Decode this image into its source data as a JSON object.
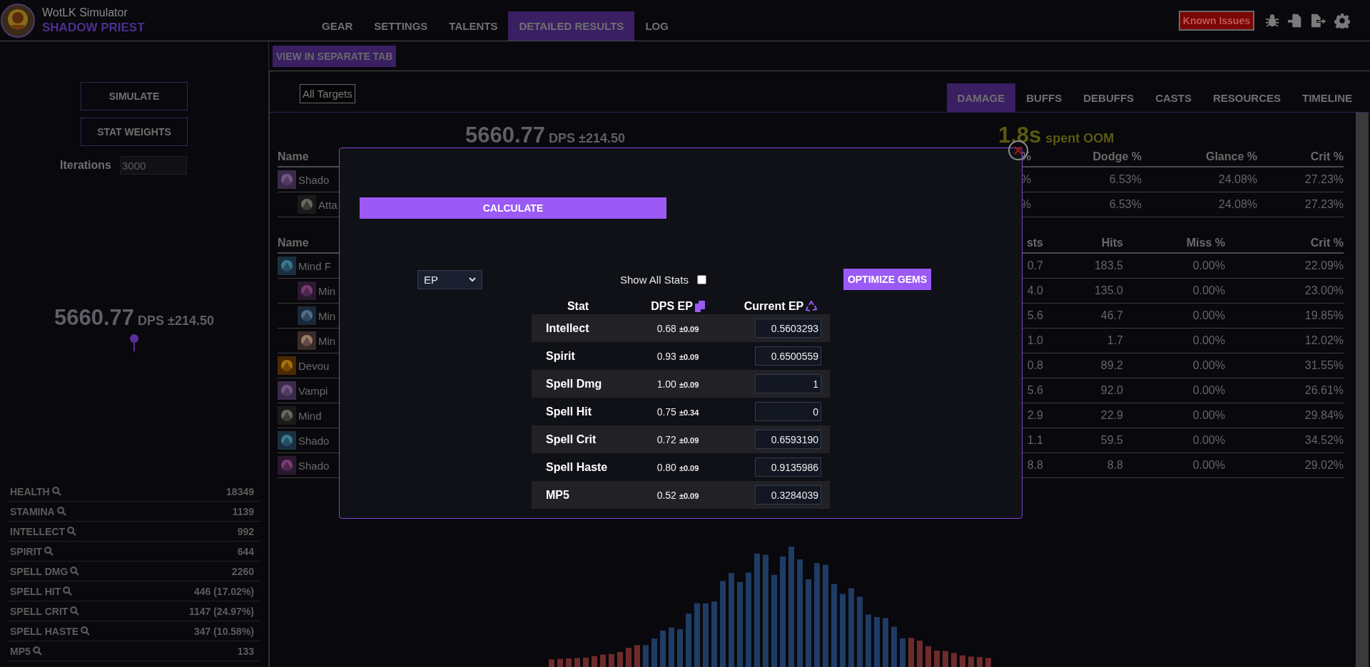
{
  "header": {
    "app_name": "WotLK Simulator",
    "spec": "SHADOW PRIEST",
    "known_issues": "Known Issues"
  },
  "nav_tabs": [
    {
      "label": "GEAR",
      "selected": false
    },
    {
      "label": "SETTINGS",
      "selected": false
    },
    {
      "label": "TALENTS",
      "selected": false
    },
    {
      "label": "DETAILED RESULTS",
      "selected": true
    },
    {
      "label": "LOG",
      "selected": false
    }
  ],
  "sidebar": {
    "buttons": [
      "SIMULATE",
      "STAT WEIGHTS"
    ],
    "iterations": {
      "label": "Iterations",
      "value": "3000"
    },
    "dps": {
      "value": "5660.77",
      "unit": "DPS",
      "error": "±214.50"
    },
    "stats": [
      {
        "name": "HEALTH",
        "value": "18349"
      },
      {
        "name": "STAMINA",
        "value": "1139"
      },
      {
        "name": "INTELLECT",
        "value": "992"
      },
      {
        "name": "SPIRIT",
        "value": "644"
      },
      {
        "name": "SPELL DMG",
        "value": "2260"
      },
      {
        "name": "SPELL HIT",
        "value": "446 (17.02%)"
      },
      {
        "name": "SPELL CRIT",
        "value": "1147 (24.97%)"
      },
      {
        "name": "SPELL HASTE",
        "value": "347 (10.58%)"
      },
      {
        "name": "MP5",
        "value": "133"
      }
    ]
  },
  "results": {
    "view_button": "VIEW IN SEPARATE TAB",
    "target_select": "All Targets",
    "tabs": [
      {
        "label": "DAMAGE",
        "selected": true
      },
      {
        "label": "BUFFS",
        "selected": false
      },
      {
        "label": "DEBUFFS",
        "selected": false
      },
      {
        "label": "CASTS",
        "selected": false
      },
      {
        "label": "RESOURCES",
        "selected": false
      },
      {
        "label": "TIMELINE",
        "selected": false
      }
    ],
    "dps": {
      "value": "5660.77",
      "unit": "DPS",
      "error": "±214.50"
    },
    "oom": {
      "value": "1.8s",
      "label": "spent OOM"
    },
    "tables": [
      {
        "columns": [
          "Name",
          "%",
          "Dodge %",
          "Glance %",
          "Crit %"
        ],
        "rows": [
          {
            "name": "Shado",
            "values": [
              "%",
              "6.53%",
              "24.08%",
              "27.23%"
            ],
            "children": [
              {
                "name": "Atta",
                "values": [
                  "%",
                  "6.53%",
                  "24.08%",
                  "27.23%"
                ]
              }
            ]
          }
        ]
      },
      {
        "columns": [
          "Name",
          "sts",
          "Hits",
          "Miss %",
          "Crit %"
        ],
        "rows": [
          {
            "name": "Mind F",
            "values": [
              "0.7",
              "183.5",
              "0.00%",
              "22.09%"
            ],
            "children": [
              {
                "name": "Min",
                "values": [
                  "4.0",
                  "135.0",
                  "0.00%",
                  "23.00%"
                ]
              },
              {
                "name": "Min",
                "values": [
                  "5.6",
                  "46.7",
                  "0.00%",
                  "19.85%"
                ]
              },
              {
                "name": "Min",
                "values": [
                  "1.0",
                  "1.7",
                  "0.00%",
                  "12.02%"
                ]
              }
            ]
          },
          {
            "name": "Devou",
            "values": [
              "0.8",
              "89.2",
              "0.00%",
              "31.55%"
            ]
          },
          {
            "name": "Vampi",
            "values": [
              "5.6",
              "92.0",
              "0.00%",
              "26.61%"
            ]
          },
          {
            "name": "Mind",
            "values": [
              "2.9",
              "22.9",
              "0.00%",
              "29.84%"
            ]
          },
          {
            "name": "Shado",
            "values": [
              "1.1",
              "59.5",
              "0.00%",
              "34.52%"
            ]
          },
          {
            "name": "Shado",
            "values": [
              "8.8",
              "8.8",
              "0.00%",
              "29.02%"
            ]
          }
        ]
      }
    ]
  },
  "modal": {
    "calculate": "CALCULATE",
    "metric_select": "EP",
    "show_all_stats": {
      "label": "Show All Stats",
      "checked": false
    },
    "optimize": "OPTIMIZE GEMS",
    "columns": [
      "Stat",
      "DPS EP",
      "Current EP"
    ],
    "rows": [
      {
        "stat": "Intellect",
        "dps_ep": "0.68",
        "error": "±0.09",
        "current_ep": "0.5603293"
      },
      {
        "stat": "Spirit",
        "dps_ep": "0.93",
        "error": "±0.09",
        "current_ep": "0.6500559"
      },
      {
        "stat": "Spell Dmg",
        "dps_ep": "1.00",
        "error": "±0.09",
        "current_ep": "1"
      },
      {
        "stat": "Spell Hit",
        "dps_ep": "0.75",
        "error": "±0.34",
        "current_ep": "0"
      },
      {
        "stat": "Spell Crit",
        "dps_ep": "0.72",
        "error": "±0.09",
        "current_ep": "0.6593190"
      },
      {
        "stat": "Spell Haste",
        "dps_ep": "0.80",
        "error": "±0.09",
        "current_ep": "0.9135986"
      },
      {
        "stat": "MP5",
        "dps_ep": "0.52",
        "error": "±0.09",
        "current_ep": "0.3284039"
      }
    ]
  }
}
